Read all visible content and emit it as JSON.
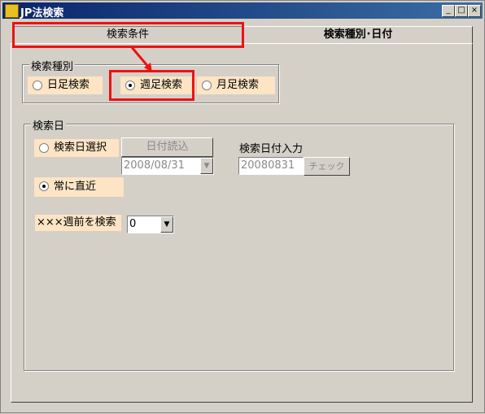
{
  "window": {
    "title": "JP法検索",
    "minimize": "_",
    "maximize": "□",
    "close": "×"
  },
  "tabs": [
    {
      "label": "検索条件"
    },
    {
      "label": "検索種別･日付"
    }
  ],
  "search_type": {
    "legend": "検索種別",
    "options": [
      {
        "label": "日足検索",
        "selected": false
      },
      {
        "label": "週足検索",
        "selected": true
      },
      {
        "label": "月足検索",
        "selected": false
      }
    ]
  },
  "search_date": {
    "legend": "検索日",
    "select_date_label": "検索日選択",
    "date_load_button": "日付読込",
    "date_combo_value": "2008/08/31",
    "input_label": "検索日付入力",
    "input_value": "20080831",
    "check_button": "チェック",
    "latest_label": "常に直近",
    "weeks_ago_label": "×××週前を検索",
    "weeks_ago_value": "0"
  },
  "annotation_color": "#ee1111"
}
